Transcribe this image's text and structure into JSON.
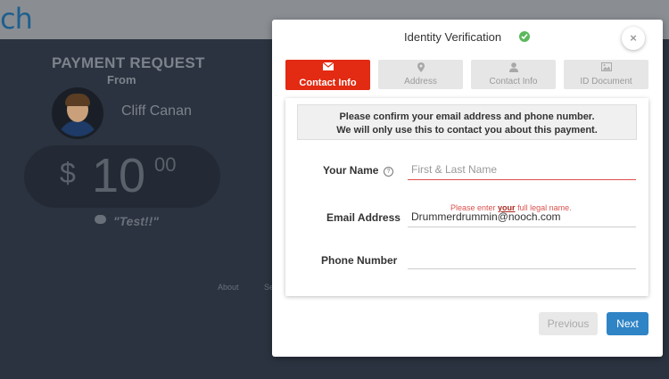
{
  "header": {
    "logo_text": "ch"
  },
  "background": {
    "title": "PAYMENT REQUEST",
    "from": "From",
    "sender_name": "Cliff Canan",
    "amount": {
      "currency": "$",
      "whole": "10",
      "cents": "00"
    },
    "memo": "\"Test!!\"",
    "footer_link": "About",
    "footer_link_cut": "Se"
  },
  "modal": {
    "title": "Identity Verification",
    "close_symbol": "×",
    "steps": [
      {
        "label": "Contact Info",
        "icon": "envelope-icon",
        "active": true
      },
      {
        "label": "Address",
        "icon": "map-marker-icon",
        "active": false
      },
      {
        "label": "Contact Info",
        "icon": "user-icon",
        "active": false
      },
      {
        "label": "ID Document",
        "icon": "image-icon",
        "active": false
      }
    ],
    "notice_line1": "Please confirm your email address and phone number.",
    "notice_line2": "We will only use this to contact you about this payment.",
    "form": {
      "name_label": "Your Name",
      "name_placeholder": "First & Last Name",
      "name_value": "",
      "name_error_pre": "Please enter ",
      "name_error_bold": "your",
      "name_error_post": " full legal name.",
      "email_label": "Email Address",
      "email_value": "Drummerdrummin@nooch.com",
      "phone_label": "Phone Number",
      "phone_value": ""
    },
    "buttons": {
      "previous": "Previous",
      "next": "Next"
    }
  },
  "colors": {
    "accent_red": "#e32a12",
    "primary_blue": "#2f84c6",
    "success_green": "#5cb85c",
    "backdrop": "#2b3341"
  }
}
